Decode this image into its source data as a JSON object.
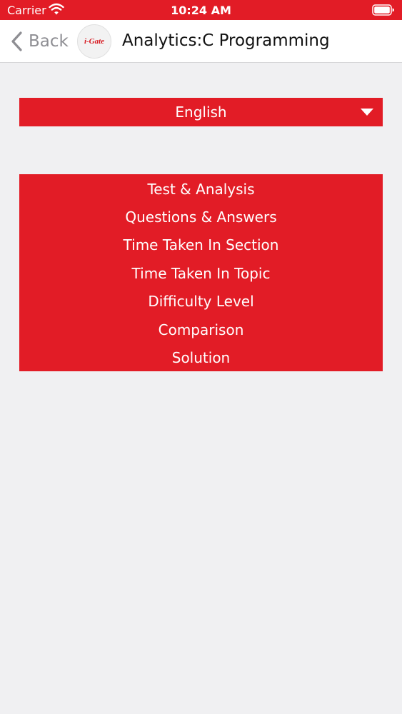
{
  "status_bar": {
    "carrier": "Carrier",
    "time": "10:24 AM",
    "icons": [
      "wifi-icon",
      "battery-icon"
    ]
  },
  "nav": {
    "back_label": "Back",
    "title": "Analytics:C Programming",
    "logo_text": "i-Gate",
    "icons": [
      "chevron-left-icon"
    ]
  },
  "language": {
    "selected": "English",
    "icon": "caret-down-icon"
  },
  "menu": {
    "items": [
      {
        "label": "Test & Analysis"
      },
      {
        "label": "Questions & Answers"
      },
      {
        "label": "Time Taken In Section"
      },
      {
        "label": "Time Taken In Topic"
      },
      {
        "label": "Difficulty Level"
      },
      {
        "label": "Comparison"
      },
      {
        "label": "Solution"
      }
    ]
  },
  "colors": {
    "accent": "#e21c26",
    "background": "#f0f0f2",
    "nav_background": "#ffffff",
    "back_text": "#8e8e93"
  }
}
